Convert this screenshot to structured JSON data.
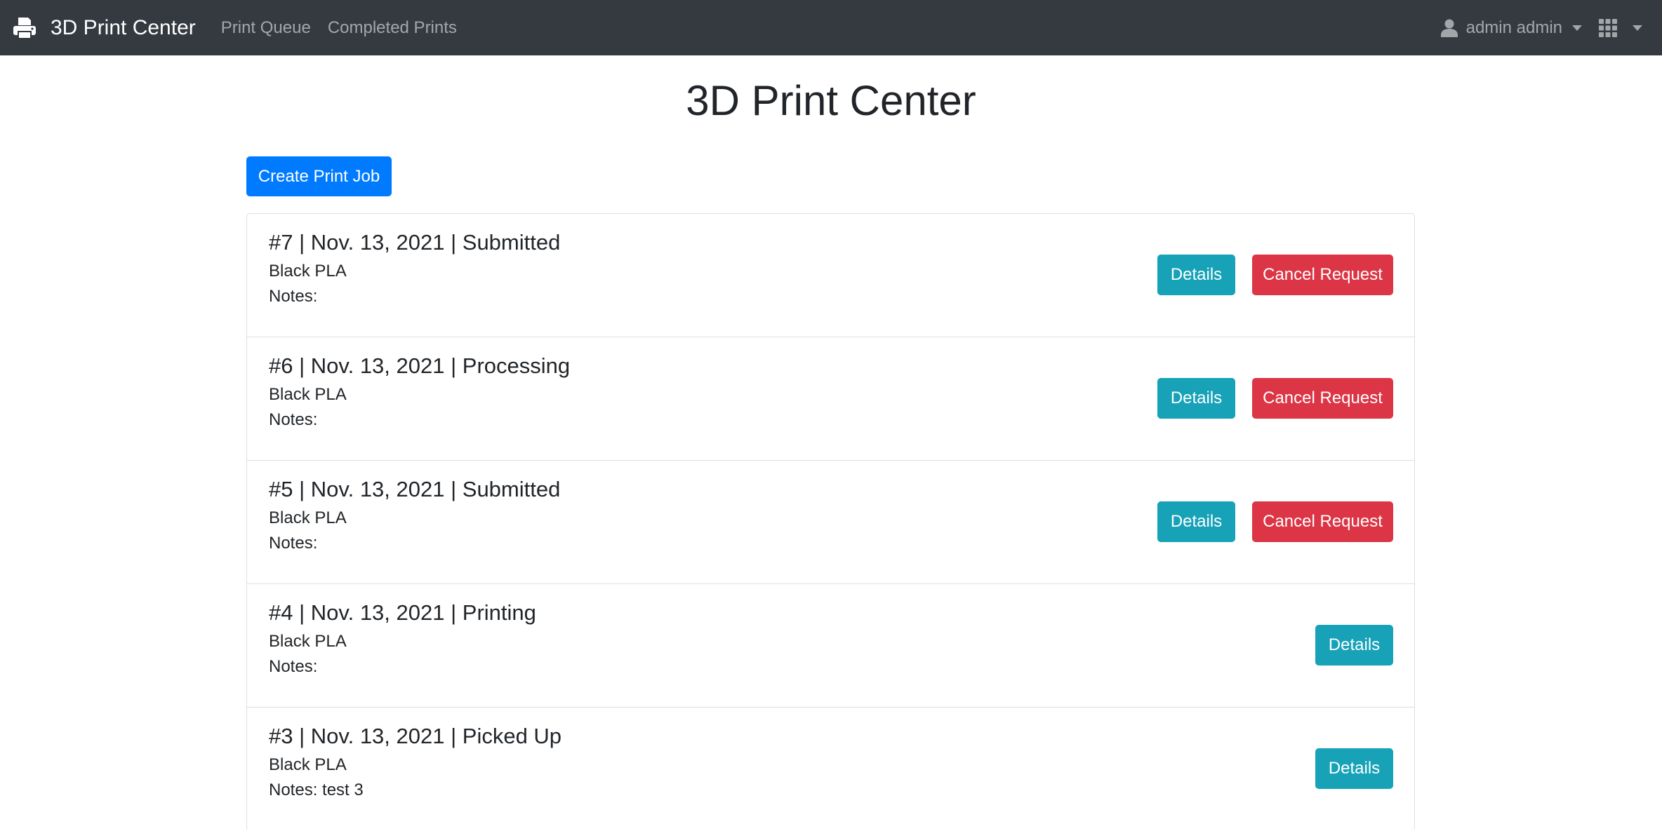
{
  "navbar": {
    "brand": "3D Print Center",
    "brand_icon": "printer-icon",
    "links": [
      "Print Queue",
      "Completed Prints"
    ],
    "user": "admin admin",
    "user_icon": "user-icon",
    "apps_icon": "grid-icon"
  },
  "page": {
    "title": "3D Print Center",
    "create_button": "Create Print Job"
  },
  "jobs": [
    {
      "title": "#7 | Nov. 13, 2021 | Submitted",
      "material": "Black PLA",
      "notes": "Notes:",
      "details_label": "Details",
      "cancel_label": "Cancel Request"
    },
    {
      "title": "#6 | Nov. 13, 2021 | Processing",
      "material": "Black PLA",
      "notes": "Notes:",
      "details_label": "Details",
      "cancel_label": "Cancel Request"
    },
    {
      "title": "#5 | Nov. 13, 2021 | Submitted",
      "material": "Black PLA",
      "notes": "Notes:",
      "details_label": "Details",
      "cancel_label": "Cancel Request"
    },
    {
      "title": "#4 | Nov. 13, 2021 | Printing",
      "material": "Black PLA",
      "notes": "Notes:",
      "details_label": "Details"
    },
    {
      "title": "#3 | Nov. 13, 2021 | Picked Up",
      "material": "Black PLA",
      "notes": "Notes: test 3",
      "details_label": "Details"
    }
  ],
  "colors": {
    "navbar": "#343a40",
    "primary": "#007bff",
    "info": "#17a2b8",
    "danger": "#dc3545"
  }
}
